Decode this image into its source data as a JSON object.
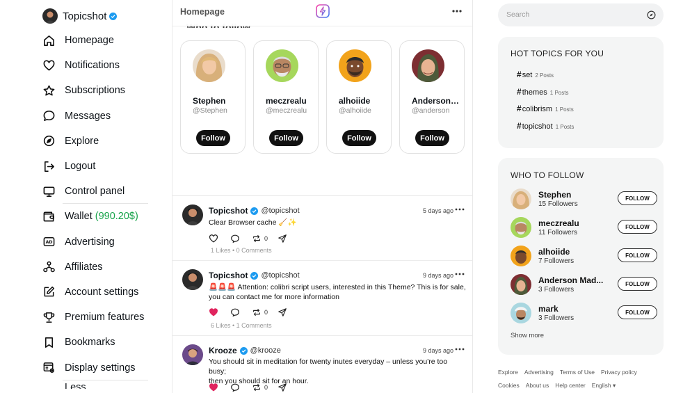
{
  "colors": {
    "accent": "#1d9bf0",
    "wallet": "#17a34a",
    "liked": "#e0245e"
  },
  "brand": {
    "name": "Topicshot"
  },
  "nav": [
    {
      "label": "Homepage",
      "icon": "home-icon"
    },
    {
      "label": "Notifications",
      "icon": "heart-icon"
    },
    {
      "label": "Subscriptions",
      "icon": "star-icon"
    },
    {
      "label": "Messages",
      "icon": "chat-bubble-icon"
    },
    {
      "label": "Explore",
      "icon": "compass-icon"
    },
    {
      "label": "Logout",
      "icon": "logout-icon"
    },
    {
      "label": "Control panel",
      "icon": "monitor-icon"
    },
    {
      "label": "Wallet",
      "icon": "wallet-icon",
      "amount": "(990.20$)"
    },
    {
      "label": "Advertising",
      "icon": "ad-icon"
    },
    {
      "label": "Affiliates",
      "icon": "affiliates-icon"
    },
    {
      "label": "Account settings",
      "icon": "edit-icon"
    },
    {
      "label": "Premium features",
      "icon": "trophy-icon"
    },
    {
      "label": "Bookmarks",
      "icon": "bookmark-icon"
    },
    {
      "label": "Display settings",
      "icon": "display-settings-icon"
    }
  ],
  "nav_more_peek": "Less",
  "header": {
    "title": "Homepage"
  },
  "who_to_follow_peek": "Who to follow",
  "suggest_cards": [
    {
      "name": "Stephen",
      "handle": "@Stephen",
      "button": "Follow"
    },
    {
      "name": "meczrealu",
      "handle": "@meczrealu",
      "button": "Follow"
    },
    {
      "name": "alhoiide",
      "handle": "@alhoiide",
      "button": "Follow"
    },
    {
      "name": "Anderson Madsen",
      "handle": "@anderson",
      "button": "Follow"
    }
  ],
  "posts": [
    {
      "author": "Topicshot",
      "handle": "@topicshot",
      "time": "5 days ago",
      "lines": [
        "Clear Browser cache 🧹✨"
      ],
      "reposts": "0",
      "liked": false,
      "stats": "1 Likes • 0 Comments"
    },
    {
      "author": "Topicshot",
      "handle": "@topicshot",
      "time": "9 days ago",
      "lines": [
        "🚨🚨🚨 Attention: colibri script users, interested in this Theme? This is for sale,",
        "you can contact me for more information"
      ],
      "reposts": "0",
      "liked": true,
      "stats": "6 Likes • 1 Comments"
    },
    {
      "author": "Krooze",
      "handle": "@krooze",
      "time": "9 days ago",
      "lines": [
        "You should sit in meditation for twenty inutes everyday – unless you're too busy;",
        "then you should sit for an hour."
      ],
      "reposts": "0",
      "liked": true,
      "stats": ""
    }
  ],
  "search": {
    "placeholder": "Search"
  },
  "hot_topics": {
    "title": "HOT TOPICS FOR YOU",
    "items": [
      {
        "tag": "set",
        "count": "2 Posts"
      },
      {
        "tag": "themes",
        "count": "1 Posts"
      },
      {
        "tag": "colibrism",
        "count": "1 Posts"
      },
      {
        "tag": "topicshot",
        "count": "1 Posts"
      }
    ]
  },
  "who_to_follow": {
    "title": "WHO TO FOLLOW",
    "items": [
      {
        "name": "Stephen",
        "followers": "15 Followers",
        "button": "FOLLOW"
      },
      {
        "name": "meczrealu",
        "followers": "11 Followers",
        "button": "FOLLOW"
      },
      {
        "name": "alhoiide",
        "followers": "7 Followers",
        "button": "FOLLOW"
      },
      {
        "name": "Anderson Mad...",
        "followers": "3 Followers",
        "button": "FOLLOW"
      },
      {
        "name": "mark",
        "followers": "3 Followers",
        "button": "FOLLOW"
      }
    ],
    "show_more": "Show more"
  },
  "footer": {
    "row1": [
      "Explore",
      "Advertising",
      "Terms of Use",
      "Privacy policy"
    ],
    "row2": [
      "Cookies",
      "About us",
      "Help center",
      "English ▾"
    ]
  }
}
